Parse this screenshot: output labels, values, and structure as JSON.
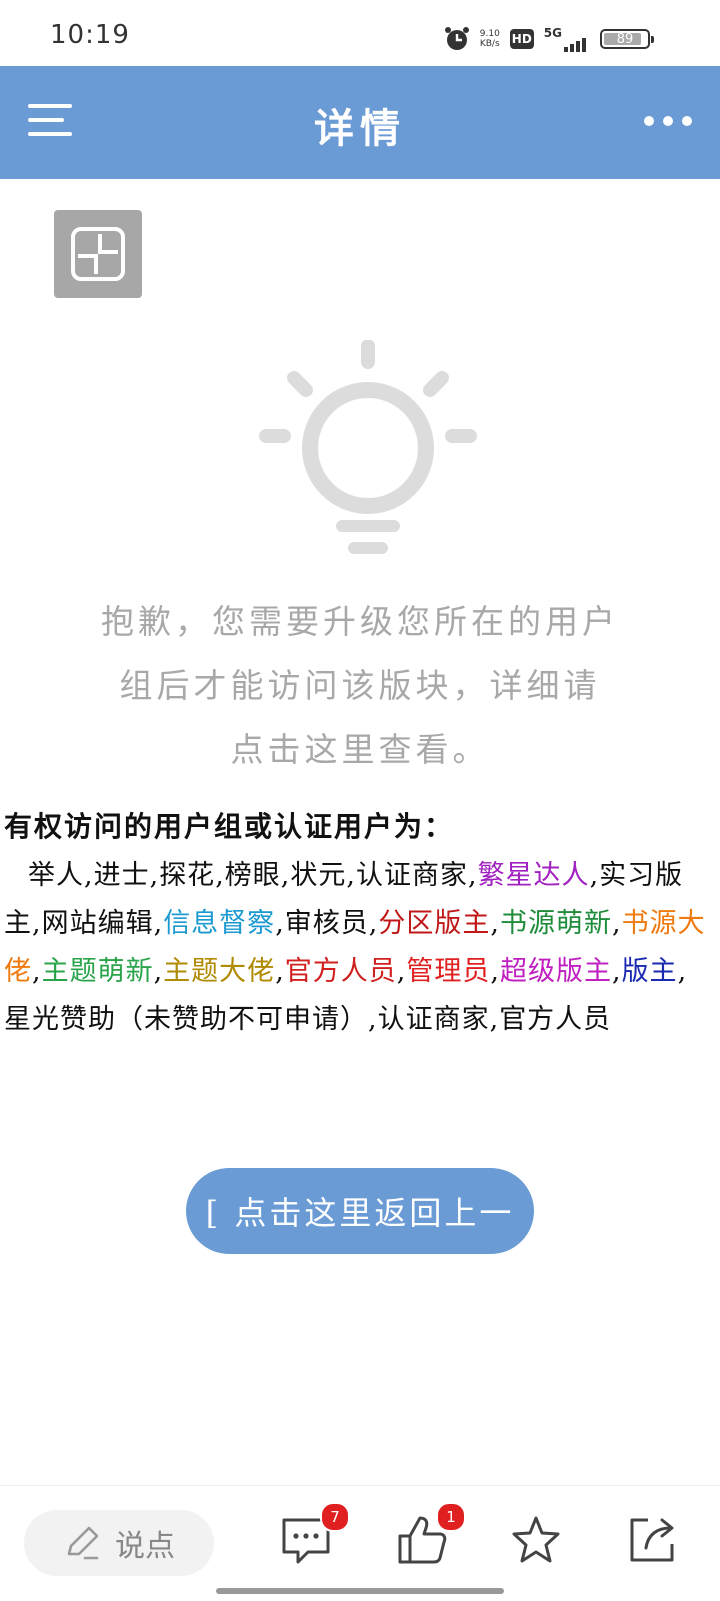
{
  "status_bar": {
    "time": "10:19",
    "net_speed_value": "9.10",
    "net_speed_unit": "KB/s",
    "hd": "HD",
    "signal": "5G",
    "battery": "89",
    "battery_level": 0.89
  },
  "app_bar": {
    "title": "详情"
  },
  "notice": {
    "line1": "抱歉，您需要升级您所在的用户",
    "line2": "组后才能访问该版块，详细请",
    "line3": "点击这里查看。"
  },
  "groups": {
    "title": "有权访问的用户组或认证用户为：",
    "items": [
      {
        "label": "举人",
        "color": "#111111"
      },
      {
        "label": "进士",
        "color": "#111111"
      },
      {
        "label": "探花",
        "color": "#111111"
      },
      {
        "label": "榜眼",
        "color": "#111111"
      },
      {
        "label": "状元",
        "color": "#111111"
      },
      {
        "label": "认证商家",
        "color": "#111111"
      },
      {
        "label": "繁星达人",
        "color": "#a020c0"
      },
      {
        "label": "实习版主",
        "color": "#111111"
      },
      {
        "label": "网站编辑",
        "color": "#111111"
      },
      {
        "label": "信息督察",
        "color": "#1a9ad0"
      },
      {
        "label": "审核员",
        "color": "#111111"
      },
      {
        "label": "分区版主",
        "color": "#c01818"
      },
      {
        "label": "书源萌新",
        "color": "#1e8c3a"
      },
      {
        "label": "书源大佬",
        "color": "#ef7b10"
      },
      {
        "label": "主题萌新",
        "color": "#2aa44a"
      },
      {
        "label": "主题大佬",
        "color": "#b08a00"
      },
      {
        "label": "官方人员",
        "color": "#d02020"
      },
      {
        "label": "管理员",
        "color": "#e02020"
      },
      {
        "label": "超级版主",
        "color": "#c020c0"
      },
      {
        "label": "版主",
        "color": "#1a2ab0"
      },
      {
        "label": "星光赞助（未赞助不可申请）",
        "color": "#111111"
      },
      {
        "label": "认证商家",
        "color": "#111111"
      },
      {
        "label": "官方人员",
        "color": "#111111"
      }
    ],
    "separator": ","
  },
  "back_button": {
    "label": "[ 点击这里返回上一"
  },
  "bottom_bar": {
    "comment_placeholder": "说点",
    "comment_count": "7",
    "like_count": "1"
  },
  "colors": {
    "accent": "#6a9bd4",
    "badge": "#e02020",
    "muted_text": "#a8a8a8"
  }
}
